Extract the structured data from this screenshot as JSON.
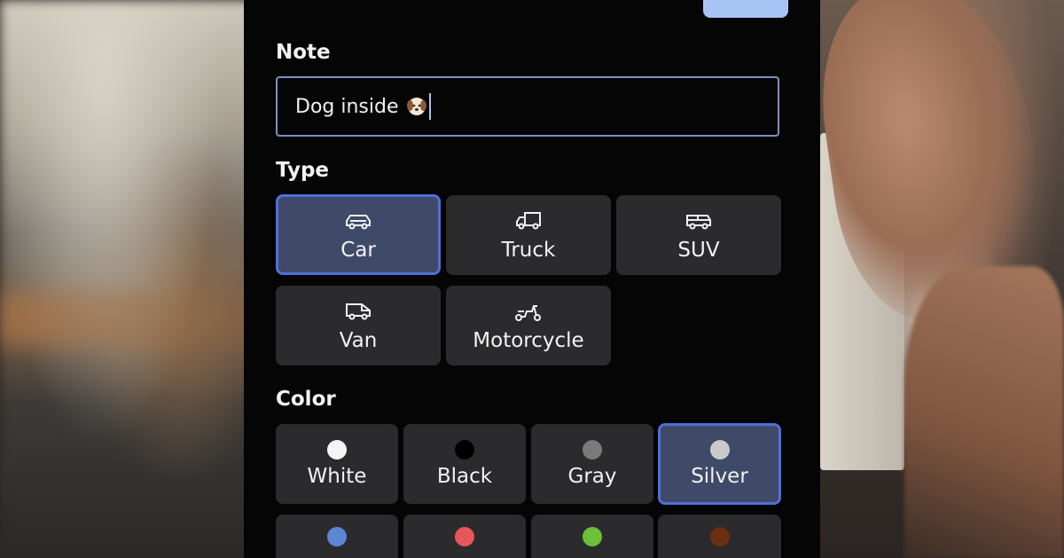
{
  "note": {
    "label": "Note",
    "value": "Dog inside",
    "emoji_icon": "dog-face-icon"
  },
  "type": {
    "label": "Type",
    "options": [
      {
        "label": "Car",
        "icon": "car-icon",
        "selected": true
      },
      {
        "label": "Truck",
        "icon": "truck-icon",
        "selected": false
      },
      {
        "label": "SUV",
        "icon": "suv-icon",
        "selected": false
      },
      {
        "label": "Van",
        "icon": "van-icon",
        "selected": false
      },
      {
        "label": "Motorcycle",
        "icon": "scooter-icon",
        "selected": false
      }
    ]
  },
  "color": {
    "label": "Color",
    "options": [
      {
        "label": "White",
        "swatch": "#f5f5f5",
        "selected": false
      },
      {
        "label": "Black",
        "swatch": "#000000",
        "selected": false
      },
      {
        "label": "Gray",
        "swatch": "#7a7a7a",
        "selected": false
      },
      {
        "label": "Silver",
        "swatch": "#c9c9c9",
        "selected": true
      }
    ],
    "partial_swatches": [
      "#5b86d6",
      "#e8565a",
      "#6cbf3a",
      "#6b2f12"
    ]
  },
  "theme": {
    "accent": "#4f6fd8",
    "selected_bg": "#3e4a68",
    "chip_bg": "#2b2b2d",
    "panel_bg": "#050505",
    "top_button": "#a8c4f5"
  }
}
